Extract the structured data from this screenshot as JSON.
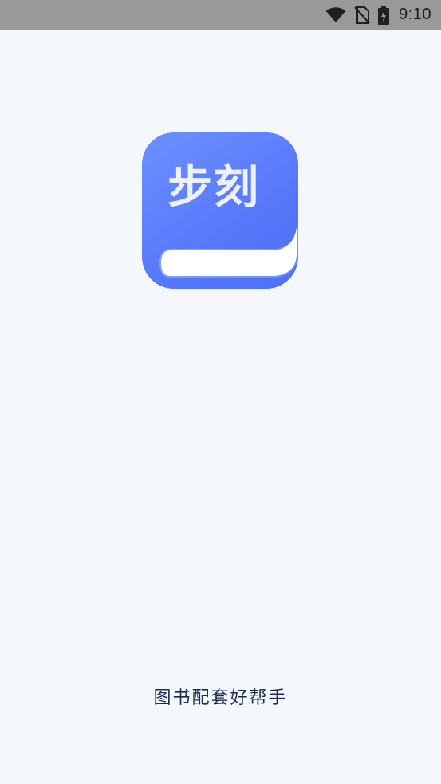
{
  "status_bar": {
    "time": "9:10",
    "icons": [
      "wifi-icon",
      "no-sim-icon",
      "battery-charging-icon"
    ]
  },
  "splash": {
    "logo_text": "步刻",
    "tagline": "图书配套好帮手"
  },
  "colors": {
    "background": "#f4f7fb",
    "status_bar": "#999999",
    "logo_blue": "#5778fb",
    "tagline": "#1d2a56"
  }
}
